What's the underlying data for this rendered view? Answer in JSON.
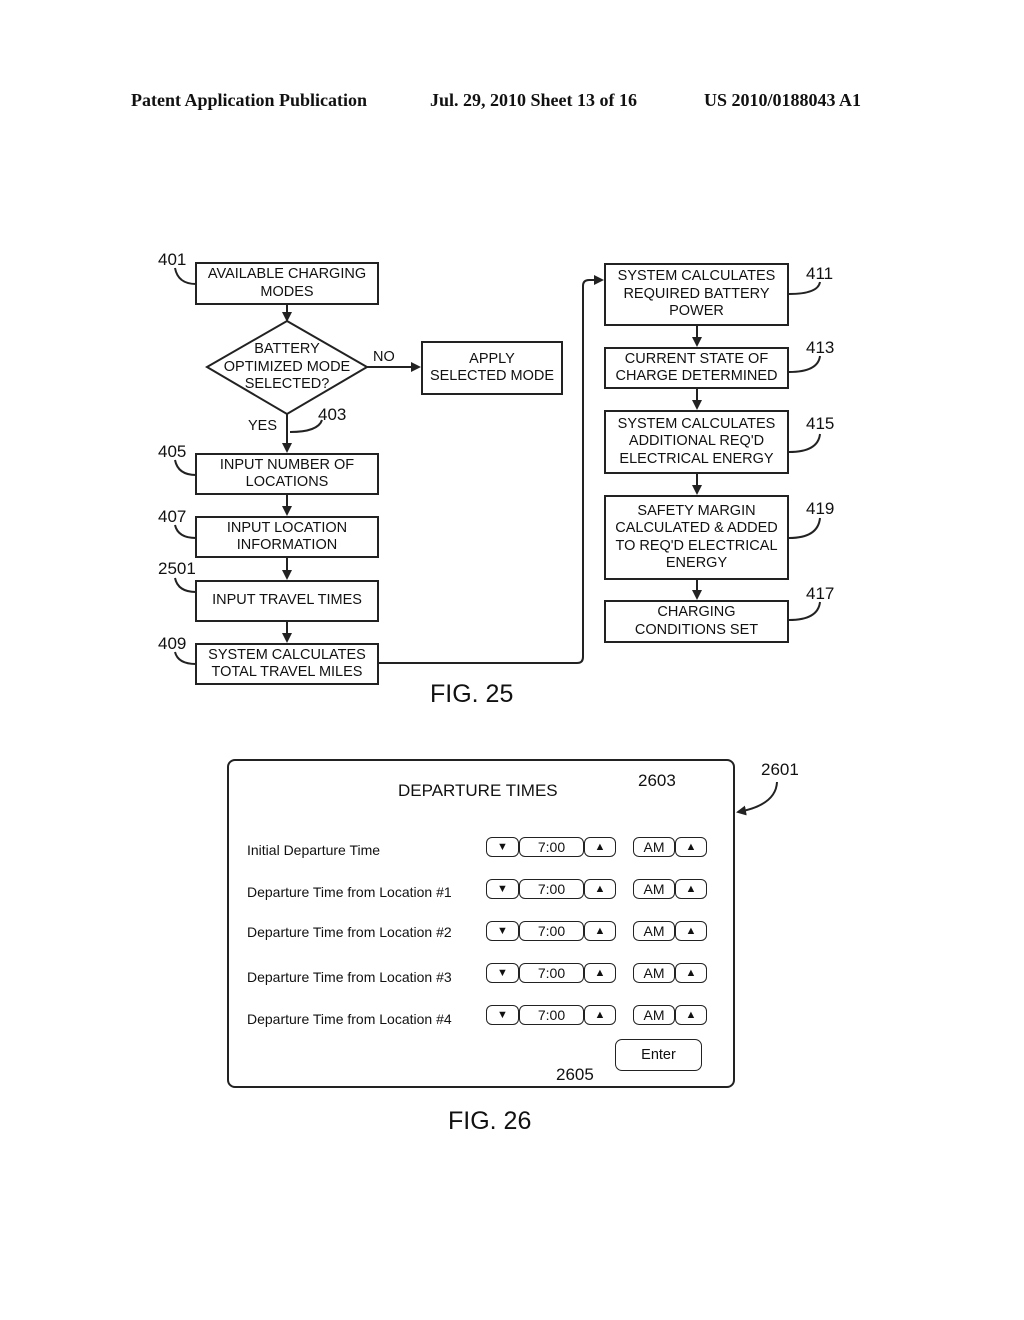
{
  "header": {
    "publication": "Patent Application Publication",
    "date_sheet": "Jul. 29, 2010   Sheet 13 of 16",
    "number": "US 2010/0188043 A1"
  },
  "fig25": {
    "caption": "FIG. 25",
    "left_column": [
      {
        "ref": "401",
        "text": "AVAILABLE CHARGING\nMODES"
      },
      {
        "ref": "403",
        "text": "BATTERY\nOPTIMIZED MODE\nSELECTED?",
        "shape": "decision"
      },
      {
        "ref": "405",
        "text": "INPUT NUMBER OF\nLOCATIONS"
      },
      {
        "ref": "407",
        "text": "INPUT LOCATION\nINFORMATION"
      },
      {
        "ref": "2501",
        "text": "INPUT TRAVEL TIMES"
      },
      {
        "ref": "409",
        "text": "SYSTEM CALCULATES\nTOTAL TRAVEL MILES"
      }
    ],
    "branch": {
      "no_label": "NO",
      "yes_label": "YES",
      "apply_box": "APPLY\nSELECTED MODE"
    },
    "right_column": [
      {
        "ref": "411",
        "text": "SYSTEM CALCULATES\nREQUIRED BATTERY\nPOWER"
      },
      {
        "ref": "413",
        "text": "CURRENT STATE OF\nCHARGE DETERMINED"
      },
      {
        "ref": "415",
        "text": "SYSTEM CALCULATES\nADDITIONAL REQ'D\nELECTRICAL ENERGY"
      },
      {
        "ref": "419",
        "text": "SAFETY MARGIN\nCALCULATED & ADDED\nTO REQ'D ELECTRICAL\nENERGY"
      },
      {
        "ref": "417",
        "text": "CHARGING\nCONDITIONS SET"
      }
    ]
  },
  "fig26": {
    "caption": "FIG. 26",
    "panel_ref": "2601",
    "control_ref": "2603",
    "enter_ref": "2605",
    "title": "DEPARTURE TIMES",
    "down_icon": "▼",
    "up_icon": "▲",
    "rows": [
      {
        "label": "Initial Departure Time",
        "time": "7:00",
        "period": "AM"
      },
      {
        "label": "Departure Time from Location #1",
        "time": "7:00",
        "period": "AM"
      },
      {
        "label": "Departure Time from Location #2",
        "time": "7:00",
        "period": "AM"
      },
      {
        "label": "Departure Time from Location #3",
        "time": "7:00",
        "period": "AM"
      },
      {
        "label": "Departure Time from Location #4",
        "time": "7:00",
        "period": "AM"
      }
    ],
    "enter_label": "Enter"
  }
}
